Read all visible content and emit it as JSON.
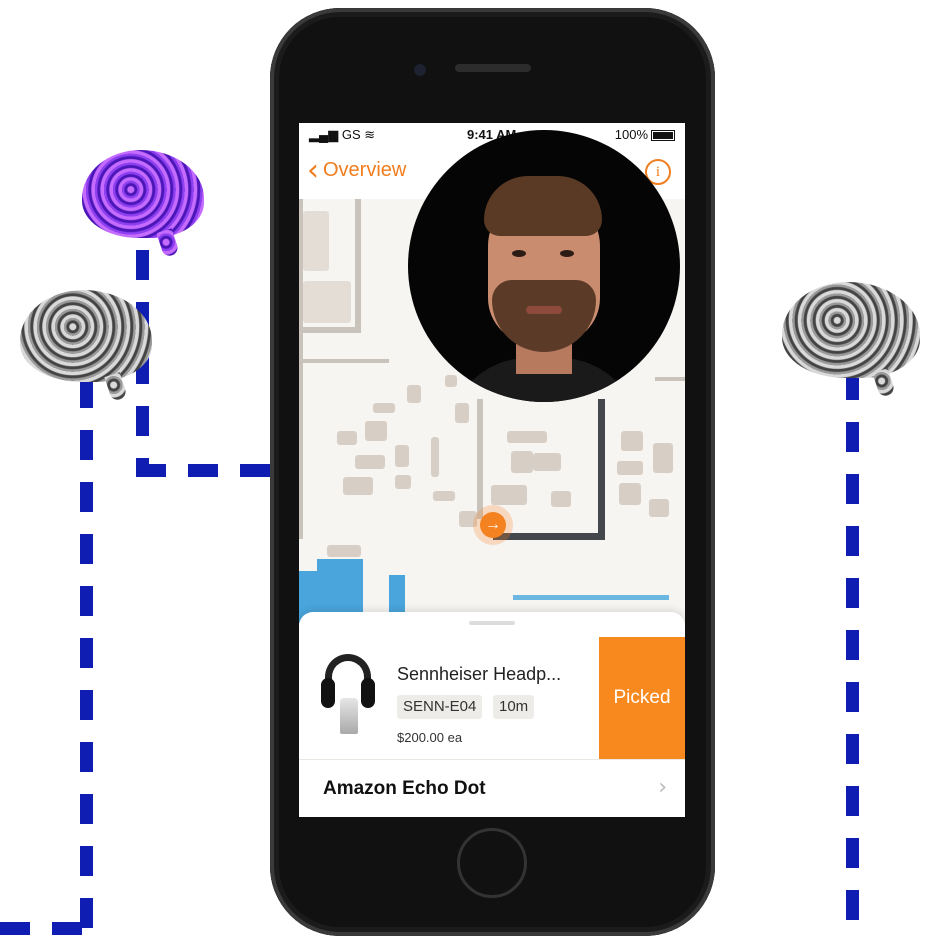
{
  "status_bar": {
    "signal": "GS",
    "time": "9:41 AM",
    "battery": "100%"
  },
  "nav": {
    "back_label": "Overview"
  },
  "product": {
    "name": "Sennheiser Headp...",
    "sku": "SENN-E04",
    "distance": "10m",
    "price": "$200.00 ea",
    "action_label": "Picked"
  },
  "next_item": {
    "name": "Amazon Echo Dot"
  },
  "colors": {
    "accent": "#f7891f",
    "route": "#44484d",
    "connector": "#0f1db3"
  },
  "icons": [
    "signal-icon",
    "wifi-icon",
    "battery-icon",
    "back-chevron-icon",
    "info-icon",
    "route-arrow-icon",
    "chevron-right-icon",
    "brain-icon"
  ]
}
